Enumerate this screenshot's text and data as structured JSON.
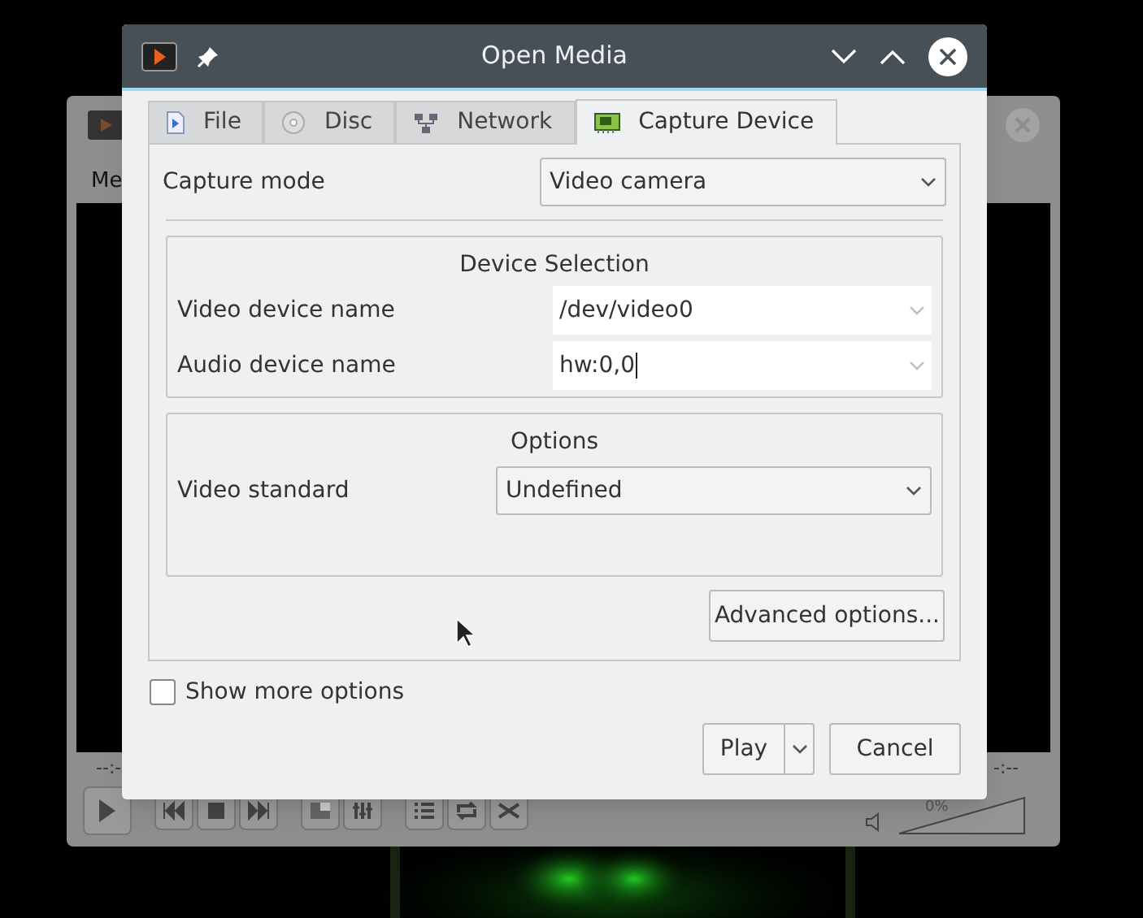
{
  "background_window": {
    "menu_text": "Me",
    "time_elapsed": "--:-",
    "time_total": "-:--",
    "volume": {
      "reading": "0%",
      "level": 0
    }
  },
  "dialog": {
    "title": "Open Media",
    "tabs": [
      {
        "label": "File",
        "kind": "file",
        "selected": false
      },
      {
        "label": "Disc",
        "kind": "disc",
        "selected": false
      },
      {
        "label": "Network",
        "kind": "network",
        "selected": false
      },
      {
        "label": "Capture Device",
        "kind": "capture",
        "selected": true
      }
    ],
    "capture_mode": {
      "label": "Capture mode",
      "value": "Video camera"
    },
    "device_selection": {
      "title": "Device Selection",
      "fields": [
        {
          "label": "Video device name",
          "value": "/dev/video0",
          "focused": false
        },
        {
          "label": "Audio device name",
          "value": "hw:0,0",
          "focused": true
        }
      ]
    },
    "options": {
      "title": "Options",
      "video_standard": {
        "label": "Video standard",
        "value": "Undefined"
      }
    },
    "advanced_button": "Advanced options...",
    "show_more_options": {
      "label": "Show more options",
      "checked": false
    },
    "buttons": {
      "play": "Play",
      "cancel": "Cancel"
    }
  }
}
